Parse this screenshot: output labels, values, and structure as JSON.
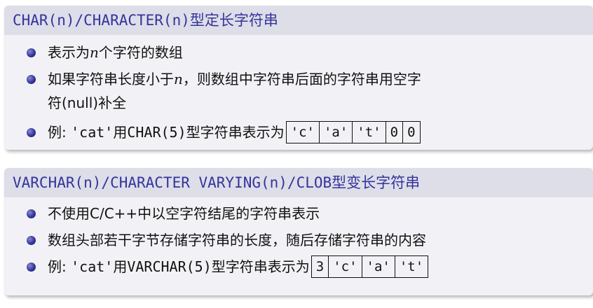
{
  "block1": {
    "title": "CHAR(n)/CHARACTER(n)型定长字符串",
    "item1": {
      "pre": "表示为",
      "var": "n",
      "post": "个字符的数组"
    },
    "item2": {
      "pre": "如果字符串长度小于",
      "var": "n",
      "post": "，则数组中字符串后面的字符串用空字",
      "line2": "符(null)补全"
    },
    "item3": {
      "pre": "例: ",
      "code": "'cat'",
      "mid": "用",
      "code2": "CHAR(5)",
      "post": "型字符串表示为",
      "cells": [
        "'c'",
        "'a'",
        "'t'",
        "0",
        "0"
      ]
    }
  },
  "block2": {
    "title": "VARCHAR(n)/CHARACTER VARYING(n)/CLOB型变长字符串",
    "item1": "不使用C/C++中以空字符结尾的字符串表示",
    "item2": "数组头部若干字节存储字符串的长度，随后存储字符串的内容",
    "item3": {
      "pre": "例: ",
      "code": "'cat'",
      "mid": "用",
      "code2": "VARCHAR(5)",
      "post": "型字符串表示为",
      "cells": [
        "3",
        "'c'",
        "'a'",
        "'t'"
      ]
    }
  },
  "colors": {
    "title": "#34349c",
    "title_bg": "#dedee9",
    "body_bg": "#f2f2f6",
    "bullet": "#34349c"
  }
}
